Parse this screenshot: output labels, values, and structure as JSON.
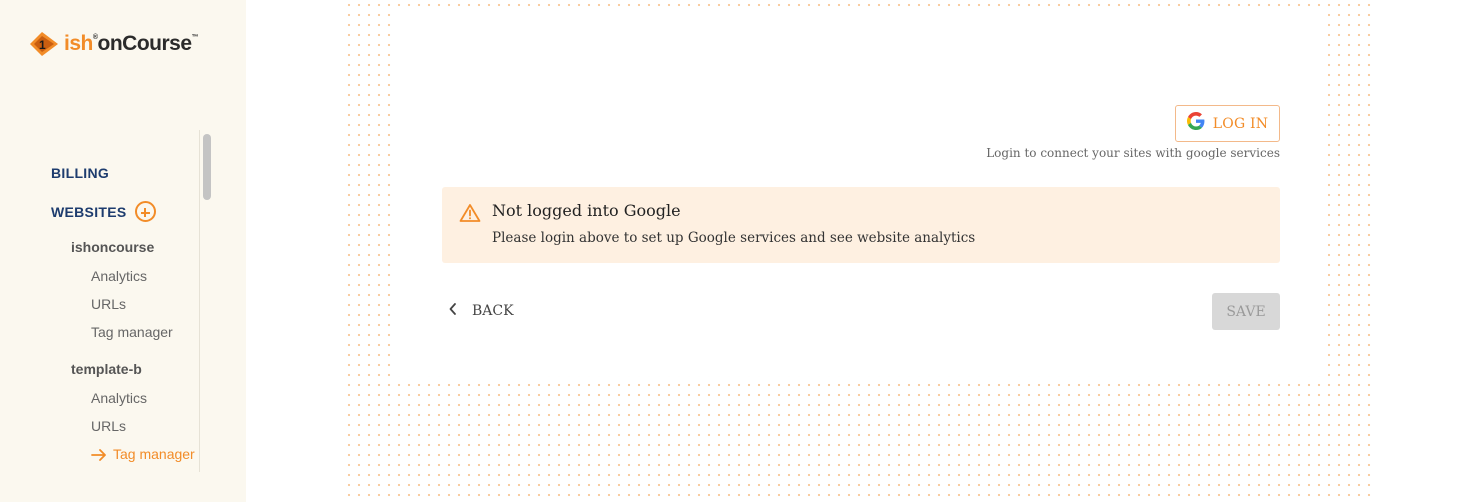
{
  "app": {
    "logo_prefix": "ish",
    "logo_name": "onCourse",
    "logo_tm": "™"
  },
  "sidebar": {
    "billing_label": "BILLING",
    "websites_label": "WEBSITES",
    "sites": [
      {
        "name": "ishoncourse",
        "items": [
          "Analytics",
          "URLs",
          "Tag manager"
        ]
      },
      {
        "name": "template-b",
        "items": [
          "Analytics",
          "URLs",
          "Tag manager"
        ],
        "active_item": "Tag manager"
      }
    ]
  },
  "main": {
    "login_button_label": "LOG IN",
    "login_help_text": "Login to connect your sites with google services",
    "alert": {
      "title": "Not logged into Google",
      "message": "Please login above to set up Google services and see website analytics"
    },
    "back_label": "BACK",
    "save_label": "SAVE"
  },
  "colors": {
    "accent": "#f28c28",
    "nav_text": "#1d3c6e",
    "sidebar_bg": "#fbf8ef",
    "alert_bg": "#fef0e1",
    "disabled_bg": "#d8d8d8"
  },
  "icons": {
    "logo": "ish-logo-icon",
    "add_website": "plus-circle-icon",
    "active_arrow": "arrow-right-icon",
    "google": "google-icon",
    "warning": "warning-triangle-icon",
    "back": "chevron-left-icon"
  }
}
